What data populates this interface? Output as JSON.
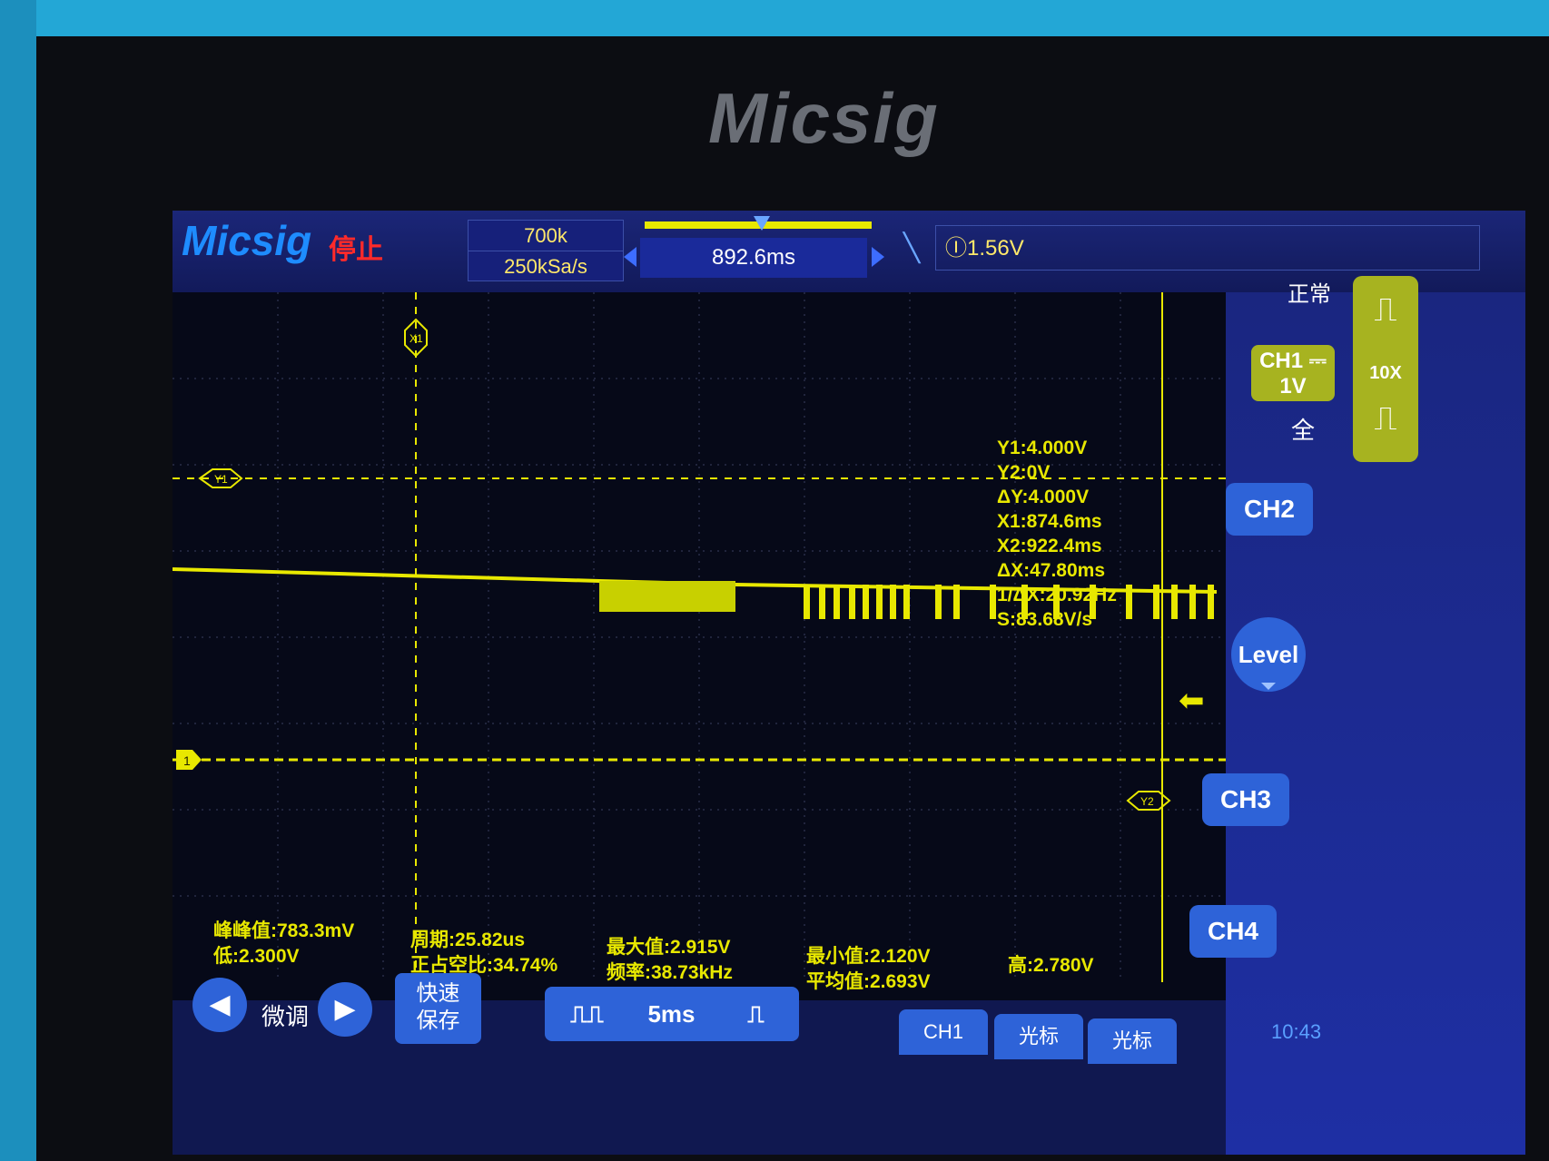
{
  "bezel": {
    "brand": "Micsig"
  },
  "header": {
    "logo": "Micsig",
    "run_state": "停止",
    "memory_depth": "700k",
    "sample_rate": "250kSa/s",
    "horizontal_position": "892.6ms",
    "trigger_level": "Ⓘ1.56V"
  },
  "right_panel": {
    "trigger_mode": "正常",
    "ch1_label": "CH1 ⎓",
    "ch1_scale": "1V",
    "ch1_coupling": "全",
    "probe_ratio": "10X",
    "ch2": "CH2",
    "level": "Level",
    "ch3": "CH3",
    "ch4": "CH4"
  },
  "cursors": {
    "x1_label": "X1",
    "x2_label": "X2",
    "y1_label": "Y1",
    "y2_label": "Y2",
    "channel_marker": "1",
    "readout": [
      "Y1:4.000V",
      "Y2:0V",
      "ΔY:4.000V",
      "X1:874.6ms",
      "X2:922.4ms",
      "ΔX:47.80ms",
      "1/ΔX:20.92Hz",
      "S:83.68V/s"
    ]
  },
  "measurements": {
    "vpp": "峰峰值:783.3mV",
    "low": "低:2.300V",
    "period": "周期:25.82us",
    "duty": "正占空比:34.74%",
    "max": "最大值:2.915V",
    "freq": "频率:38.73kHz",
    "min": "最小值:2.120V",
    "avg": "平均值:2.693V",
    "high": "高:2.780V"
  },
  "bottom_bar": {
    "fine_adjust": "微调",
    "quick_save_line1": "快速",
    "quick_save_line2": "保存",
    "timebase": "5ms",
    "ch1_btn": "CH1",
    "cursor_btn": "光标",
    "cursor_btn2": "光标",
    "clock": "10:43"
  },
  "colors": {
    "trace": "#e8e800",
    "button": "#2e63d8",
    "stop": "#ff2a2a"
  }
}
